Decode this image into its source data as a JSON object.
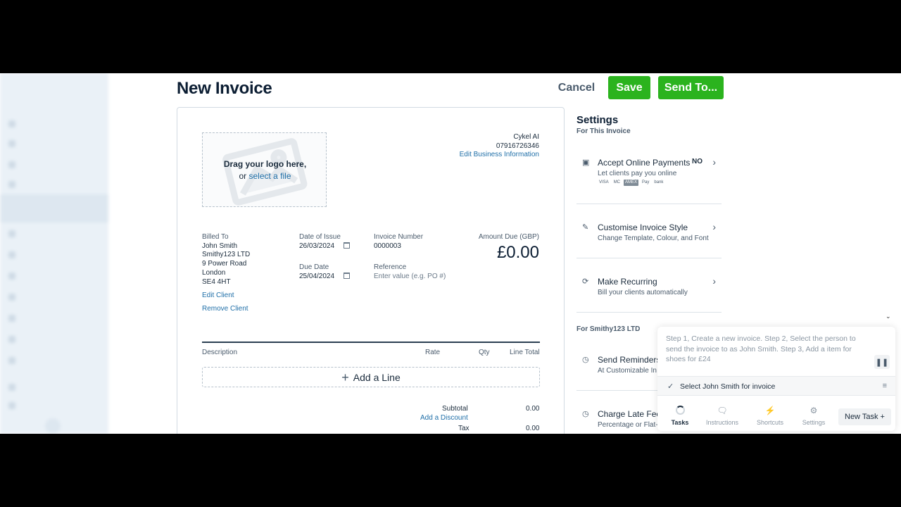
{
  "header": {
    "title": "New Invoice",
    "cancel_label": "Cancel",
    "save_label": "Save",
    "send_label": "Send To..."
  },
  "logo_dropzone": {
    "line1": "Drag your logo here,",
    "line2_prefix": "or ",
    "select_link": "select a file"
  },
  "business": {
    "name": "Cykel AI",
    "phone": "07916726346",
    "edit_label": "Edit Business Information"
  },
  "billed_to": {
    "label": "Billed To",
    "name": "John Smith",
    "company": "Smithy123 LTD",
    "street": "9 Power Road",
    "city": "London",
    "postcode": "SE4 4HT",
    "edit_label": "Edit Client",
    "remove_label": "Remove Client"
  },
  "dates": {
    "issue_label": "Date of Issue",
    "issue_value": "26/03/2024",
    "due_label": "Due Date",
    "due_value": "25/04/2024"
  },
  "invoice": {
    "number_label": "Invoice Number",
    "number_value": "0000003",
    "reference_label": "Reference",
    "reference_placeholder": "Enter value (e.g. PO #)"
  },
  "amount_due": {
    "label": "Amount Due (GBP)",
    "value": "£0.00"
  },
  "line_items": {
    "columns": [
      "Description",
      "Rate",
      "Qty",
      "Line Total"
    ],
    "add_label": "Add a Line"
  },
  "totals": {
    "subtotal_label": "Subtotal",
    "subtotal_value": "0.00",
    "discount_label": "Add a Discount",
    "tax_label": "Tax",
    "tax_value": "0.00"
  },
  "settings": {
    "title": "Settings",
    "subtitle": "For This Invoice",
    "options": [
      {
        "title": "Accept Online Payments",
        "subtitle": "Let clients pay you online",
        "status": "NO",
        "icon": "payment-icon"
      },
      {
        "title": "Customise Invoice Style",
        "subtitle": "Change Template, Colour, and Font",
        "icon": "brush-icon"
      },
      {
        "title": "Make Recurring",
        "subtitle": "Bill your clients automatically",
        "icon": "recurring-icon"
      }
    ],
    "payment_badges": [
      "VISA",
      "MC",
      "AMEX",
      "Pay",
      "bank"
    ],
    "client_section": "For Smithy123 LTD",
    "client_options": [
      {
        "title": "Send Reminders",
        "subtitle": "At Customizable In",
        "icon": "reminder-icon"
      },
      {
        "title": "Charge Late Fees",
        "subtitle": "Percentage or Flat-",
        "icon": "late-fee-icon"
      }
    ]
  },
  "assistant": {
    "prompt": "Step 1, Create a new invoice. Step 2, Select the person to send the invoice to as John Smith. Step 3, Add a item for shoes for £24",
    "current_step": "Select John Smith for invoice",
    "nav": [
      {
        "label": "Tasks",
        "icon": "spinner-icon",
        "active": true
      },
      {
        "label": "Instructions",
        "icon": "chat-icon"
      },
      {
        "label": "Shortcuts",
        "icon": "lightning-icon"
      },
      {
        "label": "Settings",
        "icon": "gear-icon"
      }
    ],
    "new_task_label": "New Task"
  }
}
